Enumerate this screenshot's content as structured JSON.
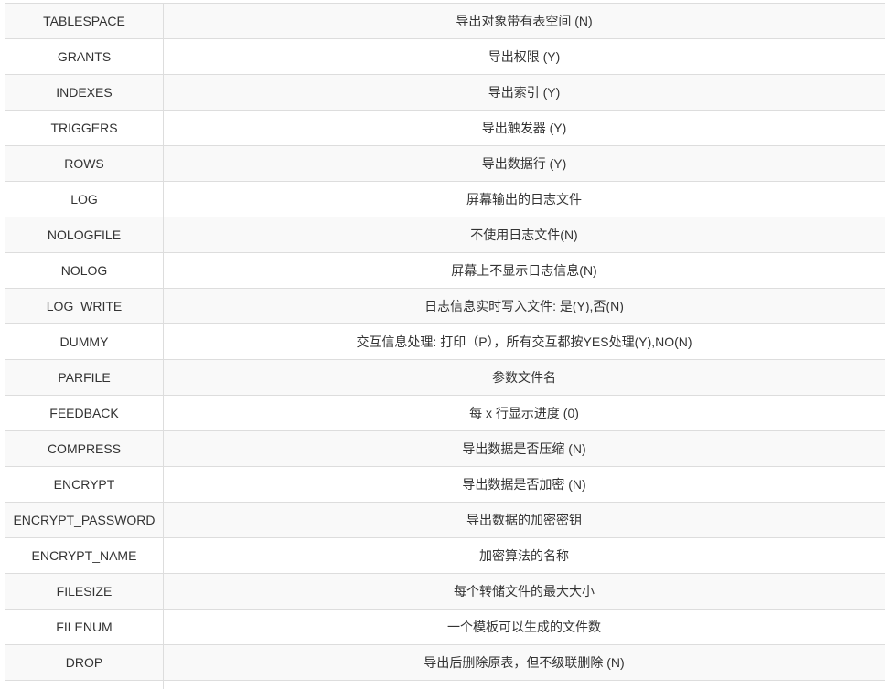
{
  "rows": [
    {
      "param": "TABLESPACE",
      "desc": "导出对象带有表空间 (N)"
    },
    {
      "param": "GRANTS",
      "desc": "导出权限 (Y)"
    },
    {
      "param": "INDEXES",
      "desc": "导出索引 (Y)"
    },
    {
      "param": "TRIGGERS",
      "desc": "导出触发器 (Y)"
    },
    {
      "param": "ROWS",
      "desc": "导出数据行 (Y)"
    },
    {
      "param": "LOG",
      "desc": "屏幕输出的日志文件"
    },
    {
      "param": "NOLOGFILE",
      "desc": "不使用日志文件(N)"
    },
    {
      "param": "NOLOG",
      "desc": "屏幕上不显示日志信息(N)"
    },
    {
      "param": "LOG_WRITE",
      "desc": "日志信息实时写入文件: 是(Y),否(N)"
    },
    {
      "param": "DUMMY",
      "desc": "交互信息处理: 打印（P），所有交互都按YES处理(Y),NO(N)"
    },
    {
      "param": "PARFILE",
      "desc": "参数文件名"
    },
    {
      "param": "FEEDBACK",
      "desc": "每 x 行显示进度 (0)"
    },
    {
      "param": "COMPRESS",
      "desc": "导出数据是否压缩 (N)"
    },
    {
      "param": "ENCRYPT",
      "desc": "导出数据是否加密 (N)"
    },
    {
      "param": "ENCRYPT_PASSWORD",
      "desc": "导出数据的加密密钥"
    },
    {
      "param": "ENCRYPT_NAME",
      "desc": "加密算法的名称"
    },
    {
      "param": "FILESIZE",
      "desc": "每个转储文件的最大大小"
    },
    {
      "param": "FILENUM",
      "desc": "一个模板可以生成的文件数"
    },
    {
      "param": "DROP",
      "desc": "导出后删除原表，但不级联删除 (N)"
    },
    {
      "param": "",
      "desc": ""
    }
  ]
}
